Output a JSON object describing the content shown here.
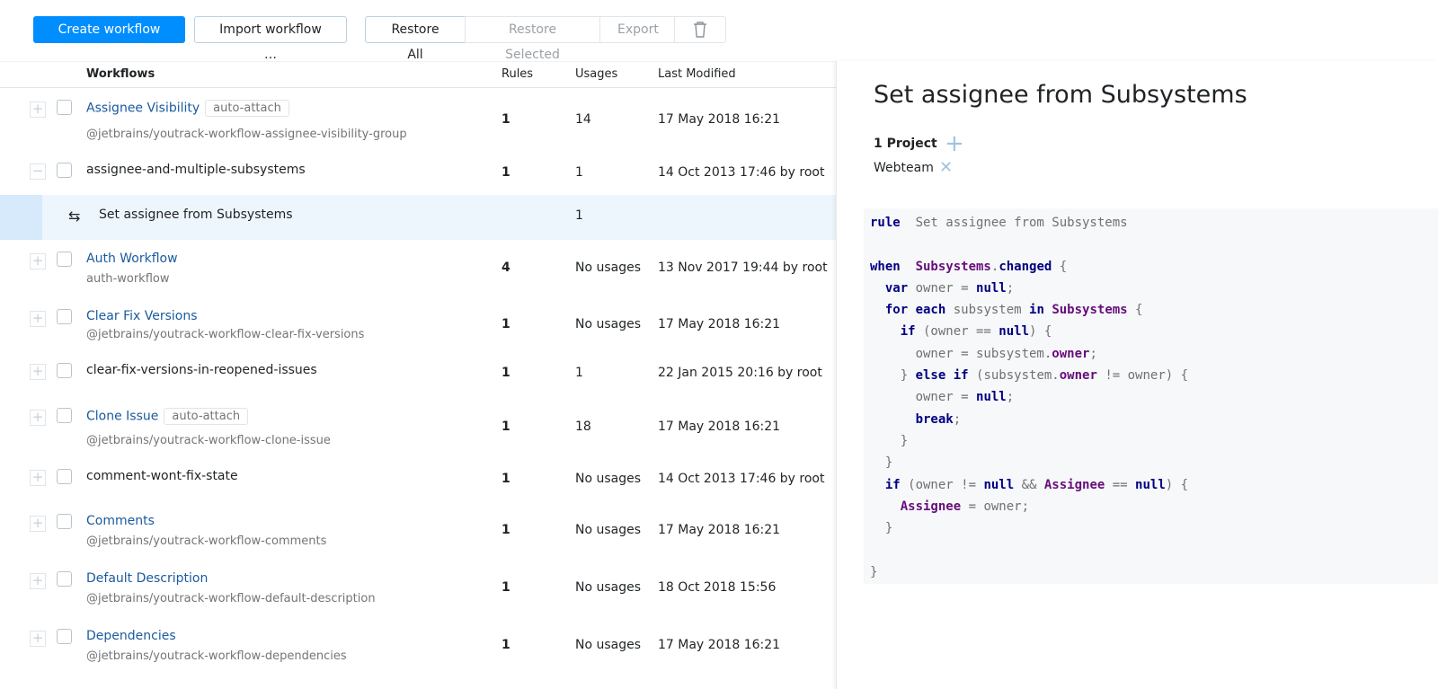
{
  "toolbar": {
    "create": "Create workflow …",
    "import": "Import workflow …",
    "restore_all": "Restore All",
    "restore_selected": "Restore Selected",
    "export": "Export",
    "delete_icon": "trash-icon"
  },
  "table": {
    "headers": {
      "workflows": "Workflows",
      "rules": "Rules",
      "usages": "Usages",
      "last_modified": "Last Modified"
    },
    "rows": [
      {
        "name": "Assignee Visibility",
        "tag": "auto-attach",
        "sub": "@jetbrains/youtrack-workflow-assignee-visibility-group",
        "rules": "1",
        "usages": "14",
        "modified": "17 May 2018 16:21"
      },
      {
        "name": "assignee-and-multiple-subsystems",
        "rules": "1",
        "usages": "1",
        "modified": "14 Oct 2013 17:46 by root"
      },
      {
        "rule": "Set assignee from Subsystems",
        "usages": "1"
      },
      {
        "name": "Auth Workflow",
        "sub": "auth-workflow",
        "rules": "4",
        "usages": "No usages",
        "modified": "13 Nov 2017 19:44 by root"
      },
      {
        "name": "Clear Fix Versions",
        "sub": "@jetbrains/youtrack-workflow-clear-fix-versions",
        "rules": "1",
        "usages": "No usages",
        "modified": "17 May 2018 16:21"
      },
      {
        "name": "clear-fix-versions-in-reopened-issues",
        "rules": "1",
        "usages": "1",
        "modified": "22 Jan 2015 20:16 by root"
      },
      {
        "name": "Clone Issue",
        "tag": "auto-attach",
        "sub": "@jetbrains/youtrack-workflow-clone-issue",
        "rules": "1",
        "usages": "18",
        "modified": "17 May 2018 16:21"
      },
      {
        "name": "comment-wont-fix-state",
        "rules": "1",
        "usages": "No usages",
        "modified": "14 Oct 2013 17:46 by root"
      },
      {
        "name": "Comments",
        "sub": "@jetbrains/youtrack-workflow-comments",
        "rules": "1",
        "usages": "No usages",
        "modified": "17 May 2018 16:21"
      },
      {
        "name": "Default Description",
        "sub": "@jetbrains/youtrack-workflow-default-description",
        "rules": "1",
        "usages": "No usages",
        "modified": "18 Oct 2018 15:56"
      },
      {
        "name": "Dependencies",
        "sub": "@jetbrains/youtrack-workflow-dependencies",
        "rules": "1",
        "usages": "No usages",
        "modified": "17 May 2018 16:21"
      }
    ]
  },
  "detail": {
    "title": "Set assignee from Subsystems",
    "projects_label": "1 Project",
    "project": "Webteam",
    "code": [
      [
        [
          "kw",
          "rule"
        ],
        [
          "",
          "  Set assignee from Subsystems"
        ]
      ],
      [],
      [
        [
          "kw",
          "when"
        ],
        [
          "",
          "  "
        ],
        [
          "fd",
          "Subsystems"
        ],
        [
          "",
          "."
        ],
        [
          "kw",
          "changed"
        ],
        [
          "",
          " {"
        ]
      ],
      [
        [
          "",
          "  "
        ],
        [
          "kw",
          "var"
        ],
        [
          "",
          " owner = "
        ],
        [
          "kw",
          "null"
        ],
        [
          "",
          ";"
        ]
      ],
      [
        [
          "",
          "  "
        ],
        [
          "kw",
          "for each"
        ],
        [
          "",
          " subsystem "
        ],
        [
          "kw",
          "in"
        ],
        [
          "",
          " "
        ],
        [
          "fd",
          "Subsystems"
        ],
        [
          "",
          " {"
        ]
      ],
      [
        [
          "",
          "    "
        ],
        [
          "kw",
          "if"
        ],
        [
          "",
          " (owner == "
        ],
        [
          "kw",
          "null"
        ],
        [
          "",
          ") {"
        ]
      ],
      [
        [
          "",
          "      owner = subsystem."
        ],
        [
          "fd",
          "owner"
        ],
        [
          "",
          ";"
        ]
      ],
      [
        [
          "",
          "    } "
        ],
        [
          "kw",
          "else if"
        ],
        [
          "",
          " (subsystem."
        ],
        [
          "fd",
          "owner"
        ],
        [
          "",
          " != owner) {"
        ]
      ],
      [
        [
          "",
          "      owner = "
        ],
        [
          "kw",
          "null"
        ],
        [
          "",
          ";"
        ]
      ],
      [
        [
          "",
          "      "
        ],
        [
          "kw",
          "break"
        ],
        [
          "",
          ";"
        ]
      ],
      [
        [
          "",
          "    }"
        ]
      ],
      [
        [
          "",
          "  }"
        ]
      ],
      [
        [
          "",
          "  "
        ],
        [
          "kw",
          "if"
        ],
        [
          "",
          " (owner != "
        ],
        [
          "kw",
          "null"
        ],
        [
          "",
          " && "
        ],
        [
          "fd",
          "Assignee"
        ],
        [
          "",
          " == "
        ],
        [
          "kw",
          "null"
        ],
        [
          "",
          ") {"
        ]
      ],
      [
        [
          "",
          "    "
        ],
        [
          "fd",
          "Assignee"
        ],
        [
          "",
          " = owner;"
        ]
      ],
      [
        [
          "",
          "  }"
        ]
      ],
      [],
      [
        [
          "",
          "}"
        ]
      ]
    ]
  }
}
